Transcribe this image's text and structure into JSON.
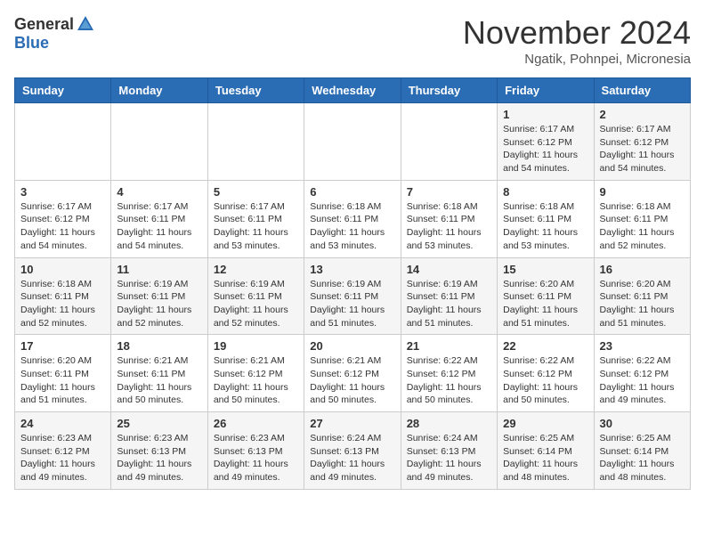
{
  "header": {
    "logo_general": "General",
    "logo_blue": "Blue",
    "month_title": "November 2024",
    "location": "Ngatik, Pohnpei, Micronesia"
  },
  "weekdays": [
    "Sunday",
    "Monday",
    "Tuesday",
    "Wednesday",
    "Thursday",
    "Friday",
    "Saturday"
  ],
  "weeks": [
    [
      {
        "day": "",
        "info": ""
      },
      {
        "day": "",
        "info": ""
      },
      {
        "day": "",
        "info": ""
      },
      {
        "day": "",
        "info": ""
      },
      {
        "day": "",
        "info": ""
      },
      {
        "day": "1",
        "info": "Sunrise: 6:17 AM\nSunset: 6:12 PM\nDaylight: 11 hours\nand 54 minutes."
      },
      {
        "day": "2",
        "info": "Sunrise: 6:17 AM\nSunset: 6:12 PM\nDaylight: 11 hours\nand 54 minutes."
      }
    ],
    [
      {
        "day": "3",
        "info": "Sunrise: 6:17 AM\nSunset: 6:12 PM\nDaylight: 11 hours\nand 54 minutes."
      },
      {
        "day": "4",
        "info": "Sunrise: 6:17 AM\nSunset: 6:11 PM\nDaylight: 11 hours\nand 54 minutes."
      },
      {
        "day": "5",
        "info": "Sunrise: 6:17 AM\nSunset: 6:11 PM\nDaylight: 11 hours\nand 53 minutes."
      },
      {
        "day": "6",
        "info": "Sunrise: 6:18 AM\nSunset: 6:11 PM\nDaylight: 11 hours\nand 53 minutes."
      },
      {
        "day": "7",
        "info": "Sunrise: 6:18 AM\nSunset: 6:11 PM\nDaylight: 11 hours\nand 53 minutes."
      },
      {
        "day": "8",
        "info": "Sunrise: 6:18 AM\nSunset: 6:11 PM\nDaylight: 11 hours\nand 53 minutes."
      },
      {
        "day": "9",
        "info": "Sunrise: 6:18 AM\nSunset: 6:11 PM\nDaylight: 11 hours\nand 52 minutes."
      }
    ],
    [
      {
        "day": "10",
        "info": "Sunrise: 6:18 AM\nSunset: 6:11 PM\nDaylight: 11 hours\nand 52 minutes."
      },
      {
        "day": "11",
        "info": "Sunrise: 6:19 AM\nSunset: 6:11 PM\nDaylight: 11 hours\nand 52 minutes."
      },
      {
        "day": "12",
        "info": "Sunrise: 6:19 AM\nSunset: 6:11 PM\nDaylight: 11 hours\nand 52 minutes."
      },
      {
        "day": "13",
        "info": "Sunrise: 6:19 AM\nSunset: 6:11 PM\nDaylight: 11 hours\nand 51 minutes."
      },
      {
        "day": "14",
        "info": "Sunrise: 6:19 AM\nSunset: 6:11 PM\nDaylight: 11 hours\nand 51 minutes."
      },
      {
        "day": "15",
        "info": "Sunrise: 6:20 AM\nSunset: 6:11 PM\nDaylight: 11 hours\nand 51 minutes."
      },
      {
        "day": "16",
        "info": "Sunrise: 6:20 AM\nSunset: 6:11 PM\nDaylight: 11 hours\nand 51 minutes."
      }
    ],
    [
      {
        "day": "17",
        "info": "Sunrise: 6:20 AM\nSunset: 6:11 PM\nDaylight: 11 hours\nand 51 minutes."
      },
      {
        "day": "18",
        "info": "Sunrise: 6:21 AM\nSunset: 6:11 PM\nDaylight: 11 hours\nand 50 minutes."
      },
      {
        "day": "19",
        "info": "Sunrise: 6:21 AM\nSunset: 6:12 PM\nDaylight: 11 hours\nand 50 minutes."
      },
      {
        "day": "20",
        "info": "Sunrise: 6:21 AM\nSunset: 6:12 PM\nDaylight: 11 hours\nand 50 minutes."
      },
      {
        "day": "21",
        "info": "Sunrise: 6:22 AM\nSunset: 6:12 PM\nDaylight: 11 hours\nand 50 minutes."
      },
      {
        "day": "22",
        "info": "Sunrise: 6:22 AM\nSunset: 6:12 PM\nDaylight: 11 hours\nand 50 minutes."
      },
      {
        "day": "23",
        "info": "Sunrise: 6:22 AM\nSunset: 6:12 PM\nDaylight: 11 hours\nand 49 minutes."
      }
    ],
    [
      {
        "day": "24",
        "info": "Sunrise: 6:23 AM\nSunset: 6:12 PM\nDaylight: 11 hours\nand 49 minutes."
      },
      {
        "day": "25",
        "info": "Sunrise: 6:23 AM\nSunset: 6:13 PM\nDaylight: 11 hours\nand 49 minutes."
      },
      {
        "day": "26",
        "info": "Sunrise: 6:23 AM\nSunset: 6:13 PM\nDaylight: 11 hours\nand 49 minutes."
      },
      {
        "day": "27",
        "info": "Sunrise: 6:24 AM\nSunset: 6:13 PM\nDaylight: 11 hours\nand 49 minutes."
      },
      {
        "day": "28",
        "info": "Sunrise: 6:24 AM\nSunset: 6:13 PM\nDaylight: 11 hours\nand 49 minutes."
      },
      {
        "day": "29",
        "info": "Sunrise: 6:25 AM\nSunset: 6:14 PM\nDaylight: 11 hours\nand 48 minutes."
      },
      {
        "day": "30",
        "info": "Sunrise: 6:25 AM\nSunset: 6:14 PM\nDaylight: 11 hours\nand 48 minutes."
      }
    ]
  ]
}
